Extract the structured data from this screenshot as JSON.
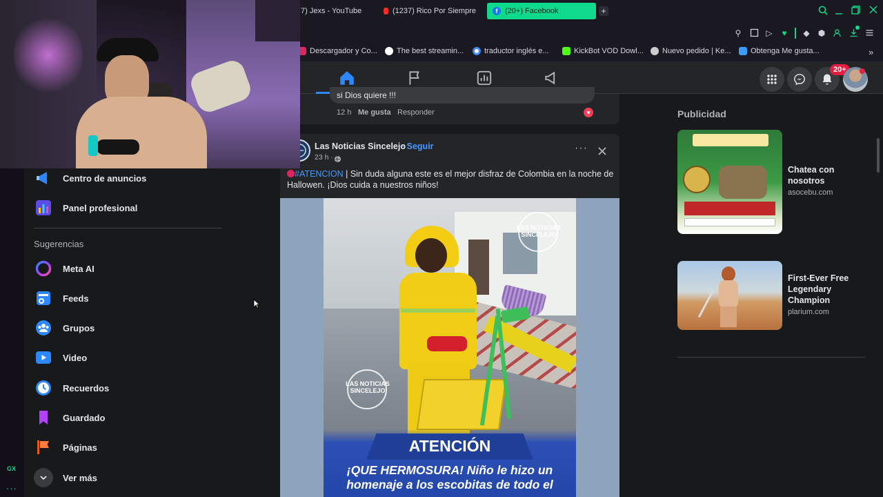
{
  "browser": {
    "tabs": [
      {
        "title": "7) Jexs - YouTube"
      },
      {
        "title": "(1237) Rico Por Siempre"
      },
      {
        "title": "(20+) Facebook",
        "active": true
      }
    ],
    "new_tab_icon": "plus-icon",
    "bookmarks": [
      {
        "label": "Descargador y Co...",
        "color": "#e0245e"
      },
      {
        "label": "The best streamin...",
        "color": "#ffffff"
      },
      {
        "label": "traductor inglés e...",
        "color": "#4285f4"
      },
      {
        "label": "KickBot VOD Dowl...",
        "color": "#53fc18"
      },
      {
        "label": "Nuevo pedido | Ke...",
        "color": "#cccccc"
      },
      {
        "label": "Obtenga Me gusta...",
        "color": "#3b9cff"
      }
    ],
    "accent": "#0fd98a",
    "sidebar_badge": "GX"
  },
  "fb": {
    "notif_badge": "20+",
    "left_menu": {
      "top_items": [
        {
          "label": "Centro de anuncios",
          "icon": "megaphone-icon"
        },
        {
          "label": "Panel profesional",
          "icon": "chart-icon"
        }
      ],
      "section_title": "Sugerencias",
      "items": [
        {
          "label": "Meta AI",
          "icon": "meta-ai-icon"
        },
        {
          "label": "Feeds",
          "icon": "feeds-icon"
        },
        {
          "label": "Grupos",
          "icon": "groups-icon"
        },
        {
          "label": "Video",
          "icon": "video-icon"
        },
        {
          "label": "Recuerdos",
          "icon": "clock-icon"
        },
        {
          "label": "Guardado",
          "icon": "bookmark-icon"
        },
        {
          "label": "Páginas",
          "icon": "flag-icon"
        }
      ],
      "more_label": "Ver más"
    },
    "comment": {
      "text": "si Dios quiere !!!",
      "time": "12 h",
      "like": "Me gusta",
      "reply": "Responder"
    },
    "post": {
      "page_name": "Las Noticias Sincelejo",
      "follow": "· Seguir",
      "time": "23 h ·",
      "hashtag": "#ATENCION",
      "text": " | Sin duda alguna este es el mejor disfraz de Colombia en la noche de Hallowen. ¡Dios cuida a nuestros niños!",
      "image_watermark_line1": "LAS NOTICIAS",
      "image_watermark_line2": "SINCELEJO",
      "image_banner": "ATENCIÓN",
      "image_caption_line1": "¡QUE HERMOSURA! Niño le hizo un",
      "image_caption_line2": "homenaje a los escobitas de todo el"
    },
    "ads": {
      "title": "Publicidad",
      "items": [
        {
          "headline": "Chatea con nosotros",
          "domain": "asocebu.com"
        },
        {
          "headline": "First-Ever Free Legendary Champion",
          "domain": "plarium.com"
        }
      ]
    }
  }
}
